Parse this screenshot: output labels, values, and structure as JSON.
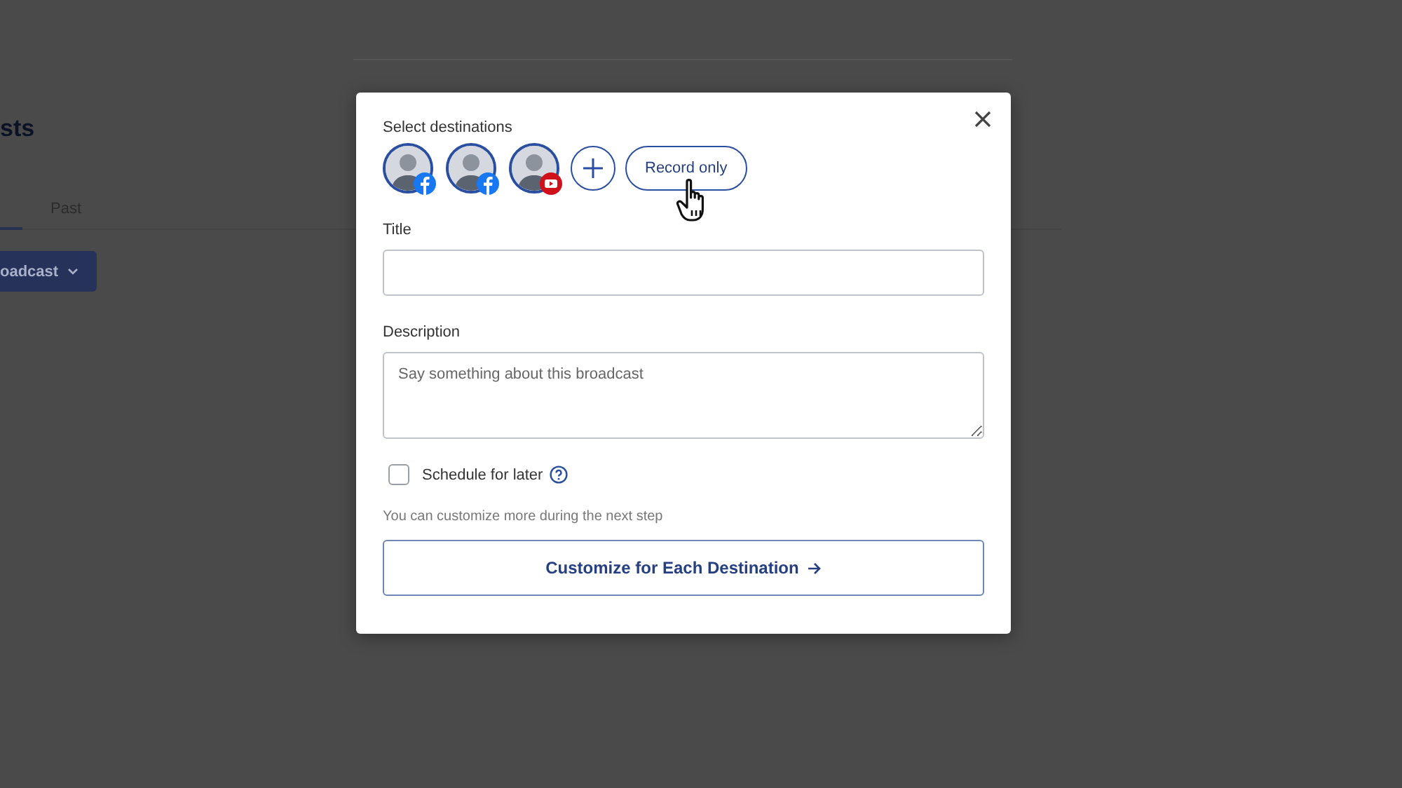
{
  "background_page": {
    "heading": "sts",
    "tabs": [
      {
        "label": "Past",
        "selected": false
      }
    ],
    "new_button": {
      "label": "oadcast"
    }
  },
  "dialog": {
    "destinations_label": "Select destinations",
    "destinations": [
      {
        "kind": "facebook",
        "selected": true
      },
      {
        "kind": "facebook",
        "selected": true
      },
      {
        "kind": "youtube",
        "selected": true
      }
    ],
    "record_only_button": "Record only",
    "title_field": {
      "label": "Title"
    },
    "description_field": {
      "label": "Description",
      "placeholder": "Say something about this broadcast"
    },
    "schedule": {
      "label": "Schedule for later",
      "checked": false
    },
    "hint": "You can customize more during the next step",
    "customize_button": "Customize for Each Destination"
  }
}
